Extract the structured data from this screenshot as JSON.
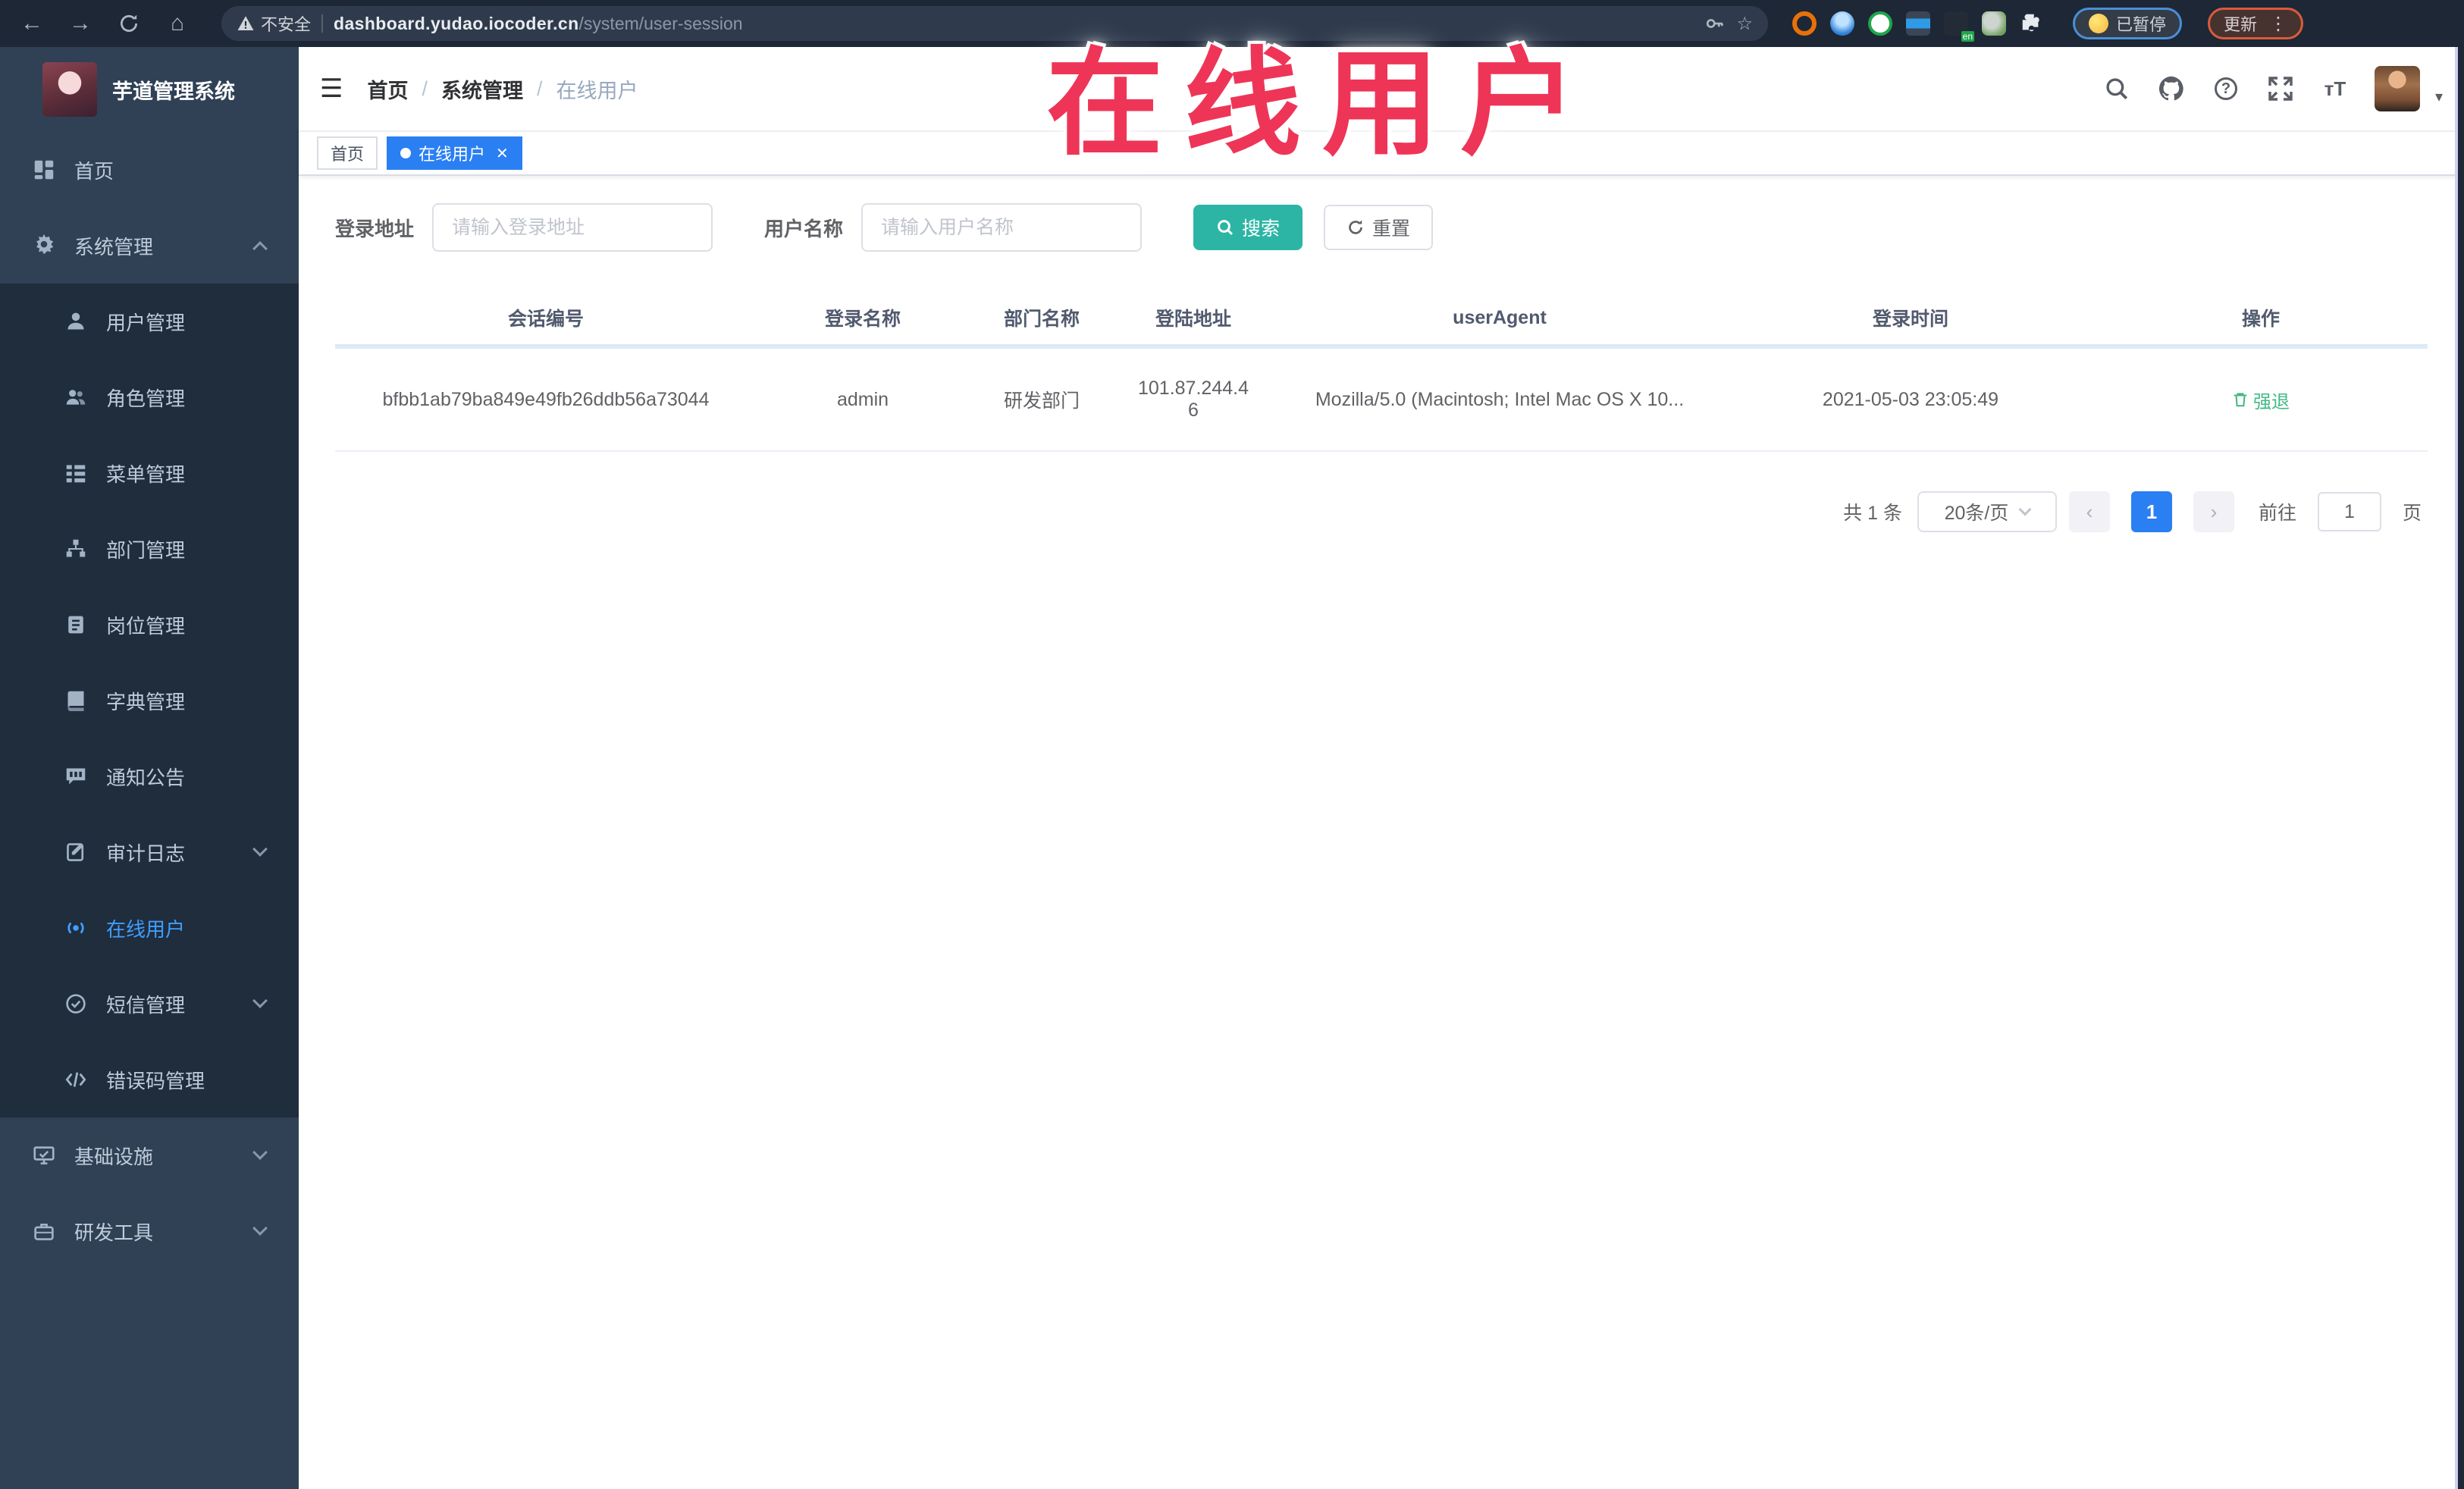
{
  "browser": {
    "security_label": "不安全",
    "url_domain": "dashboard.yudao.iocoder.cn",
    "url_path": "/system/user-session",
    "paused_badge": "已暂停",
    "update_button": "更新"
  },
  "overlay_title": "在线用户",
  "sidebar": {
    "app_title": "芋道管理系统",
    "items": [
      {
        "label": "首页"
      },
      {
        "label": "系统管理"
      },
      {
        "label": "用户管理"
      },
      {
        "label": "角色管理"
      },
      {
        "label": "菜单管理"
      },
      {
        "label": "部门管理"
      },
      {
        "label": "岗位管理"
      },
      {
        "label": "字典管理"
      },
      {
        "label": "通知公告"
      },
      {
        "label": "审计日志"
      },
      {
        "label": "在线用户"
      },
      {
        "label": "短信管理"
      },
      {
        "label": "错误码管理"
      },
      {
        "label": "基础设施"
      },
      {
        "label": "研发工具"
      }
    ]
  },
  "header": {
    "breadcrumb": [
      "首页",
      "系统管理",
      "在线用户"
    ]
  },
  "tags": {
    "home": "首页",
    "active": "在线用户"
  },
  "filters": {
    "login_address_label": "登录地址",
    "login_address_placeholder": "请输入登录地址",
    "username_label": "用户名称",
    "username_placeholder": "请输入用户名称",
    "search_button": "搜索",
    "reset_button": "重置"
  },
  "table": {
    "columns": [
      "会话编号",
      "登录名称",
      "部门名称",
      "登陆地址",
      "userAgent",
      "登录时间",
      "操作"
    ],
    "rows": [
      {
        "session_id": "bfbb1ab79ba849e49fb26ddb56a73044",
        "login_name": "admin",
        "dept_name": "研发部门",
        "login_address": "101.87.244.46",
        "user_agent": "Mozilla/5.0 (Macintosh; Intel Mac OS X 10...",
        "login_time": "2021-05-03 23:05:49",
        "action": "强退"
      }
    ]
  },
  "pagination": {
    "total_label": "共 1 条",
    "page_size": "20条/页",
    "prev": "‹",
    "current_page": "1",
    "next": "›",
    "goto_label": "前往",
    "goto_value": "1",
    "page_unit": "页"
  },
  "colors": {
    "chrome_bg": "#1d2736",
    "sidebar_bg": "#304156",
    "submenu_bg": "#1f2d3d",
    "active_menu": "#409eff",
    "tag_active": "#2a7ff3",
    "search_button": "#2cb5a5",
    "action_link": "#42b983",
    "overlay_red": "#ee3557"
  }
}
